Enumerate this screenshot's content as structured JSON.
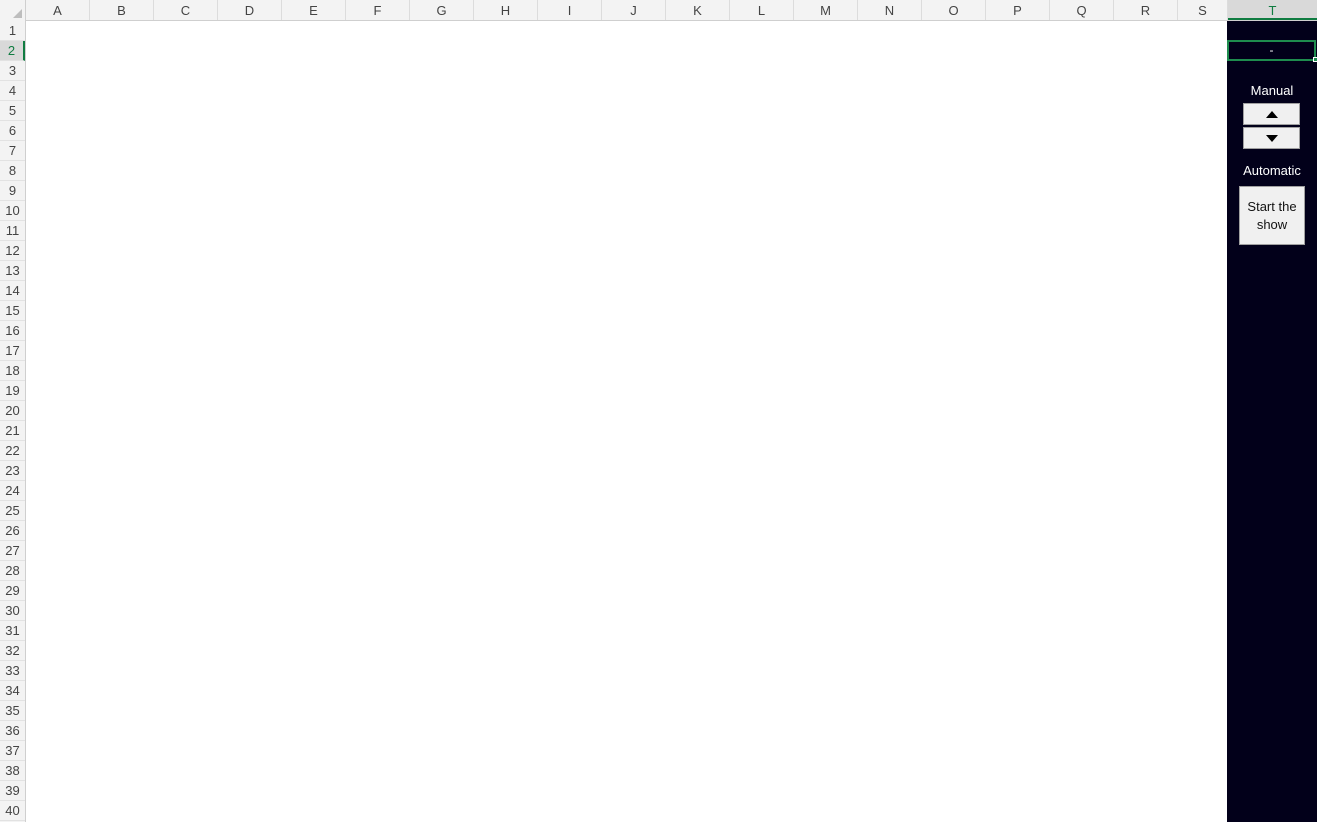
{
  "columns": [
    "A",
    "B",
    "C",
    "D",
    "E",
    "F",
    "G",
    "H",
    "I",
    "J",
    "K",
    "L",
    "M",
    "N",
    "O",
    "P",
    "Q",
    "R",
    "S",
    "T"
  ],
  "rows": [
    "1",
    "2",
    "3",
    "4",
    "5",
    "6",
    "7",
    "8",
    "9",
    "10",
    "11",
    "12",
    "13",
    "14",
    "15",
    "16",
    "17",
    "18",
    "19",
    "20",
    "21",
    "22",
    "23",
    "24",
    "25",
    "26",
    "27",
    "28",
    "29",
    "30",
    "31",
    "32",
    "33",
    "34",
    "35",
    "36",
    "37",
    "38",
    "39",
    "40"
  ],
  "active_column": "T",
  "active_row": "2",
  "selected_cell_value": "-",
  "panel": {
    "manual_label": "Manual",
    "automatic_label": "Automatic",
    "start_button_label": "Start the show",
    "background_color": "#02001a"
  },
  "colors": {
    "selection": "#1e8c4e",
    "header_active_text": "#107c41"
  }
}
